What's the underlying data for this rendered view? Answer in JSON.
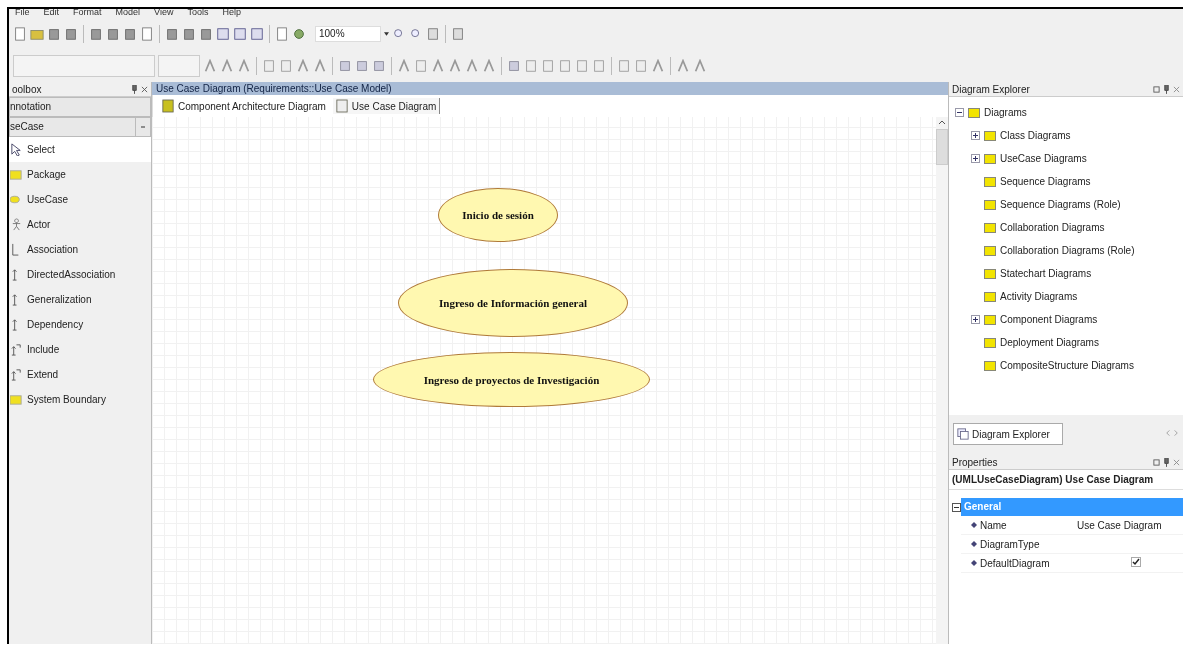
{
  "menu": [
    "File",
    "Edit",
    "Format",
    "Model",
    "View",
    "Tools",
    "Help"
  ],
  "toolbar": {
    "zoom": "100%"
  },
  "toolbox": {
    "title": "oolbox",
    "groups": [
      {
        "label": "nnotation",
        "kind": "header"
      },
      {
        "label": "seCase",
        "kind": "combo"
      }
    ],
    "items": [
      {
        "label": "Select",
        "kind": "select",
        "selected": true
      },
      {
        "label": "Package",
        "kind": "package",
        "selected": false
      },
      {
        "label": "UseCase",
        "kind": "usecase",
        "selected": false
      },
      {
        "label": "Actor",
        "kind": "actor",
        "selected": false
      },
      {
        "label": "Association",
        "kind": "line",
        "selected": false
      },
      {
        "label": "DirectedAssociation",
        "kind": "arrow",
        "selected": false
      },
      {
        "label": "Generalization",
        "kind": "arrow",
        "selected": false
      },
      {
        "label": "Dependency",
        "kind": "arrow",
        "selected": false
      },
      {
        "label": "Include",
        "kind": "stereo",
        "selected": false
      },
      {
        "label": "Extend",
        "kind": "stereo",
        "selected": false
      },
      {
        "label": "System Boundary",
        "kind": "package",
        "selected": false
      }
    ]
  },
  "editor": {
    "title": "Use Case Diagram (Requirements::Use Case Model)",
    "tabs": [
      {
        "label": "Component Architecture Diagram",
        "selected": false
      },
      {
        "label": "Use Case Diagram",
        "selected": true
      }
    ],
    "use_cases": [
      "Inicio de sesión",
      "Ingreso de Información general",
      "Ingreso de proyectos de Investigación"
    ]
  },
  "diagram_explorer": {
    "title": "Diagram Explorer",
    "tree": [
      {
        "label": "Diagrams",
        "kind": "group",
        "expanded": true,
        "children": [
          {
            "label": "Class Diagrams",
            "kind": "group",
            "expanded": false
          },
          {
            "label": "UseCase Diagrams",
            "kind": "group",
            "expanded": false
          },
          {
            "label": "Sequence Diagrams",
            "kind": "leaf"
          },
          {
            "label": "Sequence Diagrams (Role)",
            "kind": "leaf"
          },
          {
            "label": "Collaboration Diagrams",
            "kind": "leaf"
          },
          {
            "label": "Collaboration Diagrams (Role)",
            "kind": "leaf"
          },
          {
            "label": "Statechart Diagrams",
            "kind": "leaf"
          },
          {
            "label": "Activity Diagrams",
            "kind": "leaf"
          },
          {
            "label": "Component Diagrams",
            "kind": "group",
            "expanded": false
          },
          {
            "label": "Deployment Diagrams",
            "kind": "leaf"
          },
          {
            "label": "CompositeStructure Diagrams",
            "kind": "leaf"
          }
        ]
      }
    ],
    "tab": "Diagram Explorer"
  },
  "properties": {
    "title": "Properties",
    "heading": "(UMLUseCaseDiagram) Use Case Diagram",
    "category": "General",
    "rows": [
      {
        "name": "Name",
        "kind": "text",
        "value": "Use Case Diagram"
      },
      {
        "name": "DiagramType",
        "kind": "text"
      },
      {
        "name": "DefaultDiagram",
        "kind": "check",
        "checked": true
      }
    ]
  }
}
